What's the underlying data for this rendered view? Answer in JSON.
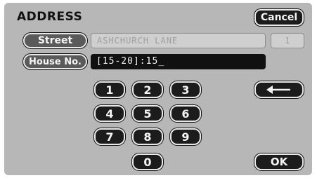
{
  "title": "ADDRESS",
  "cancel_label": "Cancel",
  "street": {
    "label": "Street",
    "value": "ASHCHURCH LANE",
    "count": "1"
  },
  "house": {
    "label": "House No.",
    "value": "[15-20]:15_"
  },
  "keypad": {
    "keys": [
      "1",
      "2",
      "3",
      "4",
      "5",
      "6",
      "7",
      "8",
      "9",
      "0"
    ]
  },
  "backspace_icon": "left-arrow",
  "ok_label": "OK"
}
